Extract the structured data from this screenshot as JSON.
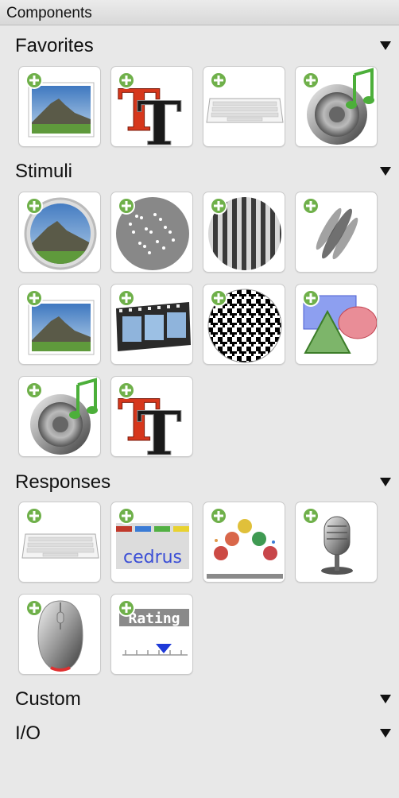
{
  "panel": {
    "title": "Components"
  },
  "sections": {
    "favorites": {
      "title": "Favorites"
    },
    "stimuli": {
      "title": "Stimuli"
    },
    "responses": {
      "title": "Responses"
    },
    "custom": {
      "title": "Custom"
    },
    "io": {
      "title": "I/O"
    }
  },
  "labels": {
    "text_glyph": "T",
    "cedrus": "cedrus",
    "rating": "Rating"
  },
  "icons": {
    "add": "plus-circle-icon",
    "collapse": "triangle-down-icon"
  },
  "colors": {
    "add_badge": "#6fb04a",
    "background": "#e8e8e8"
  }
}
